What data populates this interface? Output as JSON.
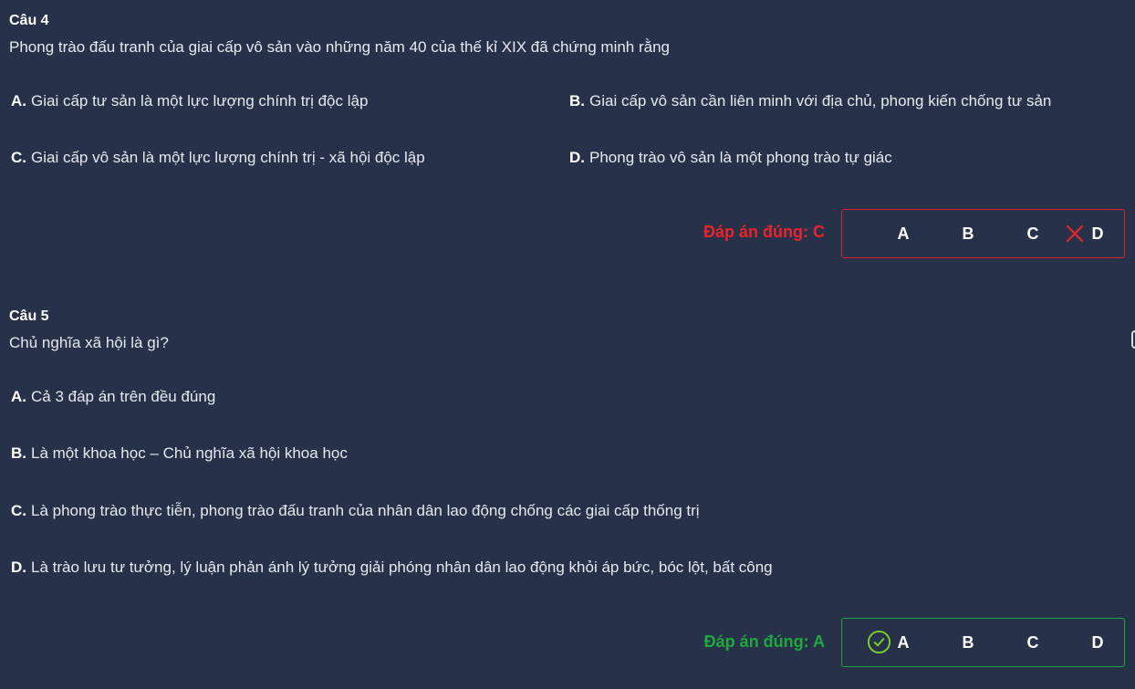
{
  "questions": [
    {
      "title": "Câu 4",
      "text": "Phong trào đấu tranh của giai cấp vô sản vào những năm 40 của thế kỉ XIX đã chứng minh rằng",
      "options": [
        {
          "letter": "A.",
          "text": "Giai cấp tư sản là một lực lượng chính trị độc lập"
        },
        {
          "letter": "B.",
          "text": "Giai cấp vô sản cần liên minh với địa chủ, phong kiến chống tư sản"
        },
        {
          "letter": "C.",
          "text": "Giai cấp vô sản là một lực lượng chính trị - xã hội độc lập"
        },
        {
          "letter": "D.",
          "text": "Phong trào vô sản là một phong trào tự giác"
        }
      ],
      "answer_label": "Đáp án đúng: C",
      "choices": [
        "A",
        "B",
        "C",
        "D"
      ],
      "selected": "D",
      "result": "wrong",
      "result_color": "#e8242a"
    },
    {
      "title": "Câu 5",
      "text": "Chủ nghĩa xã hội là gì?",
      "options": [
        {
          "letter": "A.",
          "text": "Cả 3 đáp án trên đều đúng"
        },
        {
          "letter": "B.",
          "text": "Là một khoa học – Chủ nghĩa xã hội khoa học"
        },
        {
          "letter": "C.",
          "text": "Là phong trào thực tiễn, phong trào đấu tranh của nhân dân lao động chống các giai cấp thống trị"
        },
        {
          "letter": "D.",
          "text": "Là trào lưu tư tưởng, lý luận phản ánh lý tưởng giải phóng nhân dân lao động khỏi áp bức, bóc lột, bất công"
        }
      ],
      "answer_label": "Đáp án đúng: A",
      "choices": [
        "A",
        "B",
        "C",
        "D"
      ],
      "selected": "A",
      "result": "correct",
      "result_color": "#1fa83c"
    }
  ]
}
